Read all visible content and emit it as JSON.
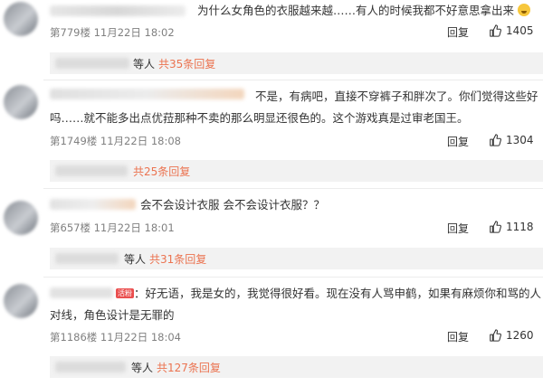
{
  "comments": [
    {
      "text_line1": "为什么女角色的衣服越来越……有人的时候我都不好意思拿出来",
      "meta": "第779楼  11月22日 18:02",
      "reply_label": "回复",
      "likes": "1405",
      "sub_people": "等人",
      "sub_count": "共35条回复"
    },
    {
      "text_line1": "不是，有病吧，直接不穿裤子和胖次了。你们觉得这些好",
      "text_line2": "吗……就不能多出点优菈那种不卖的那么明显还很色的。这个游戏真是过审老国王。",
      "meta": "第1749楼  11月22日 18:08",
      "reply_label": "回复",
      "likes": "1304",
      "sub_people": "等人",
      "sub_count": "共25条回复"
    },
    {
      "text_line1": "会不会设计衣服 会不会设计衣服？？",
      "meta": "第657楼  11月22日 18:01",
      "reply_label": "回复",
      "likes": "1118",
      "sub_people": "等人",
      "sub_count": "共31条回复"
    },
    {
      "tag": "活粉",
      "text_line1": "：好无语，我是女的，我觉得很好看。现在没有人骂申鹤，如果有麻烦你和骂的人",
      "text_line2": "对线，角色设计是无罪的",
      "meta": "第1186楼  11月22日 18:04",
      "reply_label": "回复",
      "likes": "1260",
      "sub_people": "等人",
      "sub_count": "共127条回复"
    }
  ],
  "colors": {
    "accent": "#eb7350",
    "meta": "#808080",
    "sub_bg": "#f2f2f2"
  },
  "icons": {
    "like": "thumbs-up-icon",
    "avatar": "user-avatar-icon"
  }
}
